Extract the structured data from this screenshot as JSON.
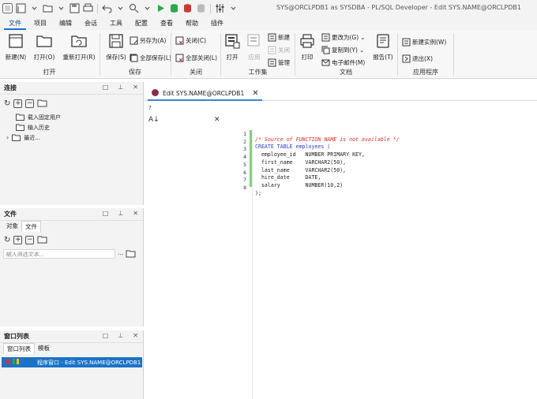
{
  "window": {
    "title": "SYS@ORCLPDB1 as SYSDBA - PL/SQL Developer - Edit SYS.NAME@ORCLPDB1"
  },
  "menu": [
    "文件",
    "项目",
    "编辑",
    "会话",
    "工具",
    "配置",
    "查看",
    "帮助",
    "插件"
  ],
  "ribbon": {
    "open_group": {
      "new": "新建(N)",
      "open": "打开(O)",
      "reopen": "重新打开(R)",
      "label": "打开"
    },
    "save_group": {
      "save": "保存(S)",
      "save_as": "另存为(A)",
      "save_all": "全部保存(L)",
      "label": "保存"
    },
    "close_group": {
      "close": "关闭(C)",
      "close_all": "全部关闭(L)",
      "label": "关闭"
    },
    "workspace_group": {
      "open": "打开",
      "apply": "应用",
      "new": "新建",
      "close": "关闭",
      "manage": "管理",
      "label": "工作集"
    },
    "doc_group": {
      "print": "打印",
      "change_to": "更改为(G)",
      "copy_to": "复制到(Y)",
      "email": "电子邮件(M)",
      "report": "报告(T)",
      "label": "文档"
    },
    "app_group": {
      "new_instance": "新建实例(W)",
      "exit": "退出(X)",
      "label": "应用程序"
    }
  },
  "connections_panel": {
    "title": "连接",
    "items": [
      "载入固定用户",
      "输入历史",
      "最近..."
    ]
  },
  "files_panel": {
    "title": "文件",
    "tabs": [
      "对象",
      "文件"
    ],
    "filter_placeholder": "输入筛选文本...",
    "browse": "..."
  },
  "window_list_panel": {
    "title": "窗口列表",
    "tabs": [
      "窗口列表",
      "模板"
    ],
    "item": "程序窗口 - Edit SYS.NAME@ORCLPDB1"
  },
  "editor": {
    "tab_title": "Edit SYS.NAME@ORCLPDB1",
    "question_mark": "?",
    "line_numbers": [
      "1",
      "2",
      "3",
      "4",
      "5",
      "6",
      "7",
      "8"
    ],
    "code_lines": [
      "/* Source of FUNCTION NAME is not available */",
      "CREATE TABLE employees (",
      "  employee_id   NUMBER PRIMARY KEY,",
      "  first_name    VARCHAR2(50),",
      "  last_name     VARCHAR2(50),",
      "  hire_date     DATE,",
      "  salary        NUMBER(10,2)",
      ");"
    ]
  },
  "colors": {
    "accent": "#1a73c8",
    "comment": "#e03030",
    "keyword": "#2a3fd0",
    "change_bar": "#7ed27e"
  }
}
